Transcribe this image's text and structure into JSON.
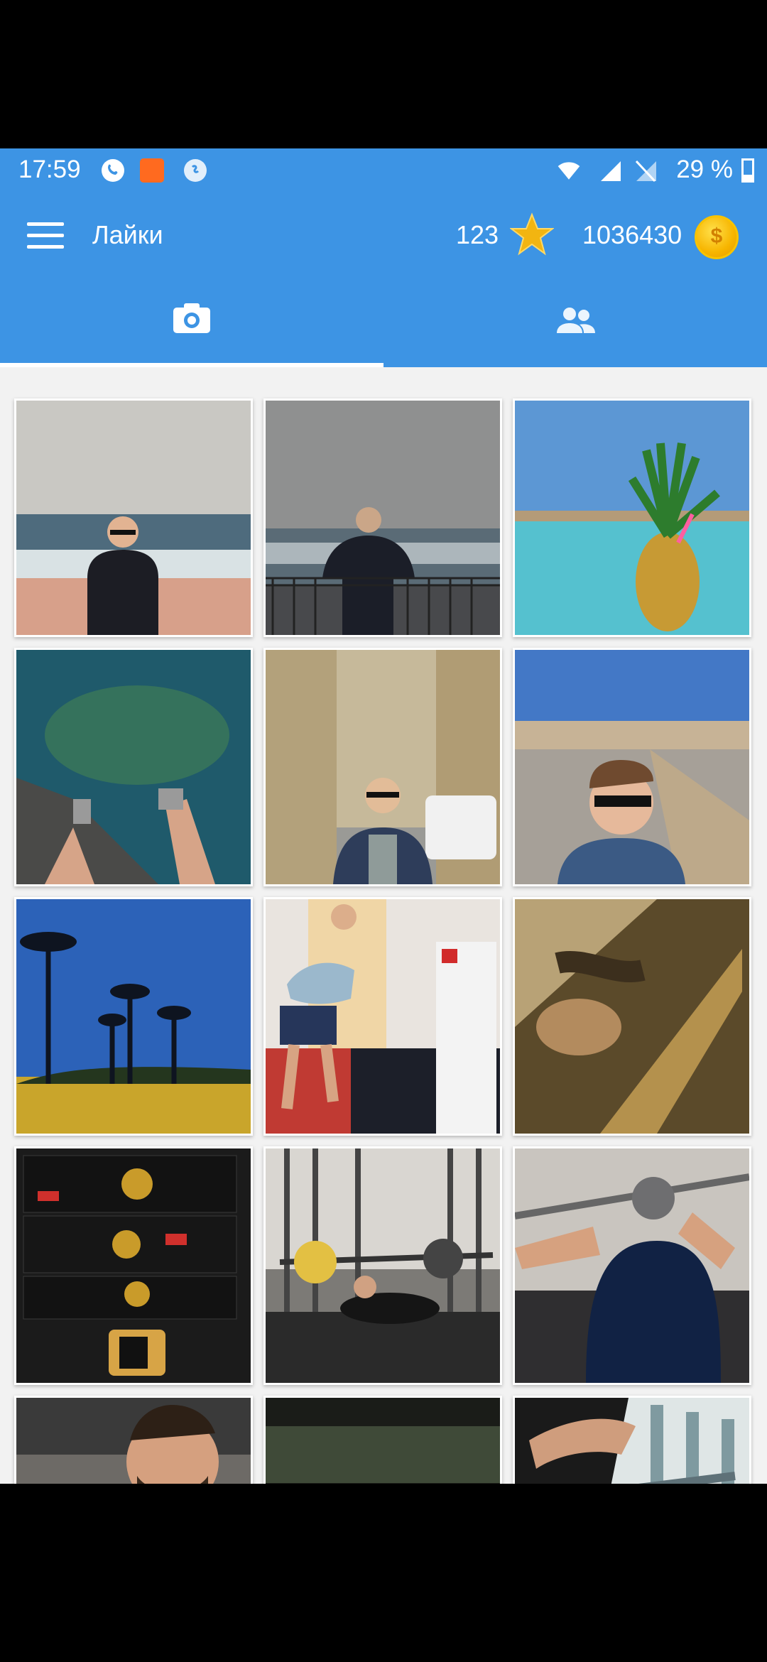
{
  "status_bar": {
    "time": "17:59",
    "battery": "29 %"
  },
  "app_bar": {
    "title": "Лайки",
    "stars_count": "123",
    "coins_count": "1036430",
    "menu_icon": "hamburger-menu-icon",
    "star_icon": "star-icon",
    "coin_icon": "coin-icon"
  },
  "tabs": [
    {
      "icon": "camera-icon",
      "selected": true
    },
    {
      "icon": "people-icon",
      "selected": false
    }
  ],
  "colors": {
    "primary": "#3d94e4",
    "background": "#f2f2f2",
    "star": "#f2b511",
    "coin": "#f7b500"
  },
  "grid": {
    "columns": 3,
    "tiles": [
      {
        "desc": "Мужчина в очках у моря"
      },
      {
        "desc": "Мужчина на набережной спиной"
      },
      {
        "desc": "Ананас над морем"
      },
      {
        "desc": "Ноги над бирюзовой водой"
      },
      {
        "desc": "Селфи на улице города"
      },
      {
        "desc": "Селфи у дороги"
      },
      {
        "desc": "Пальмы вечером"
      },
      {
        "desc": "Упражнение в спортзале"
      },
      {
        "desc": "Размытый снимок"
      },
      {
        "desc": "Коробки видеокарт"
      },
      {
        "desc": "Жим лежа в спортзале"
      },
      {
        "desc": "Приседания со штангой"
      },
      {
        "desc": "Селфи в спортзале"
      },
      {
        "desc": "Размытый кадр"
      },
      {
        "desc": "Тренажеры"
      }
    ]
  }
}
